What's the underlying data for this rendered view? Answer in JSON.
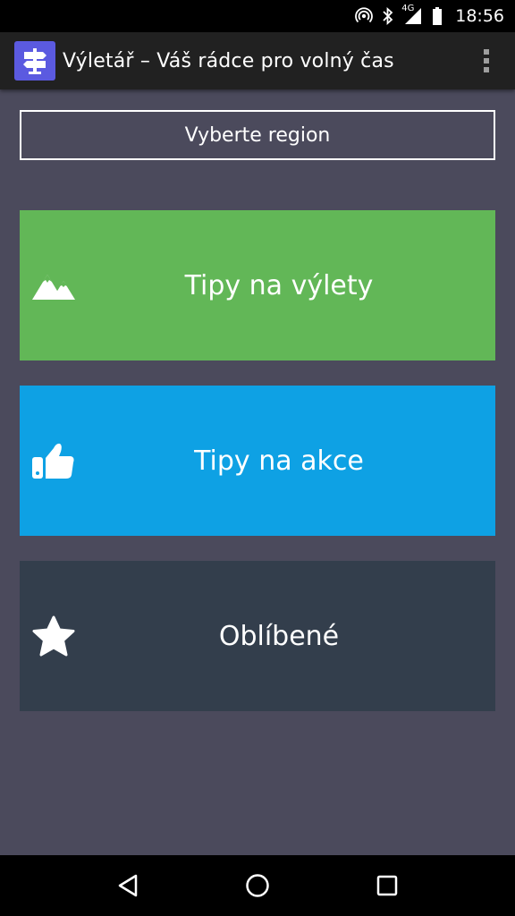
{
  "status_bar": {
    "time": "18:56",
    "network": "4G",
    "icons": [
      "hotspot-icon",
      "bluetooth-icon",
      "signal-icon",
      "battery-icon"
    ]
  },
  "app_bar": {
    "title": "Výletář – Váš rádce pro volný čas",
    "logo_icon": "signpost-icon",
    "menu_icon": "overflow-menu-icon"
  },
  "region": {
    "label": "Vyberte region"
  },
  "tiles": [
    {
      "label": "Tipy na výlety",
      "icon": "mountains-icon",
      "color": "#62b757"
    },
    {
      "label": "Tipy na akce",
      "icon": "thumbs-up-icon",
      "color": "#0ea1e4"
    },
    {
      "label": "Oblíbené",
      "icon": "star-icon",
      "color": "#333e4c"
    }
  ],
  "colors": {
    "background": "#4b4a5c",
    "app_bar": "#212121",
    "logo": "#5b5ae0"
  },
  "nav_bar": {
    "icons": [
      "back-icon",
      "home-icon",
      "recents-icon"
    ]
  }
}
